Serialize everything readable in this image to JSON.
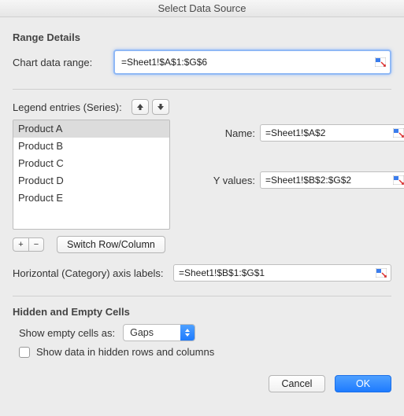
{
  "title": "Select Data Source",
  "range_details": {
    "heading": "Range Details",
    "chart_data_range_label": "Chart data range:",
    "chart_data_range_value": "=Sheet1!$A$1:$G$6"
  },
  "legend": {
    "label": "Legend entries (Series):",
    "items": [
      {
        "label": "Product A",
        "selected": true
      },
      {
        "label": "Product B",
        "selected": false
      },
      {
        "label": "Product C",
        "selected": false
      },
      {
        "label": "Product D",
        "selected": false
      },
      {
        "label": "Product E",
        "selected": false
      }
    ],
    "switch_label": "Switch Row/Column",
    "name_label": "Name:",
    "name_value": "=Sheet1!$A$2",
    "yvalues_label": "Y values:",
    "yvalues_value": "=Sheet1!$B$2:$G$2"
  },
  "haxis": {
    "label": "Horizontal (Category) axis labels:",
    "value": "=Sheet1!$B$1:$G$1"
  },
  "hidden_empty": {
    "heading": "Hidden and Empty Cells",
    "show_empty_label": "Show empty cells as:",
    "show_empty_value": "Gaps",
    "show_hidden_label": "Show data in hidden rows and columns"
  },
  "footer": {
    "cancel": "Cancel",
    "ok": "OK"
  },
  "icons": {
    "add": "+",
    "remove": "−"
  }
}
